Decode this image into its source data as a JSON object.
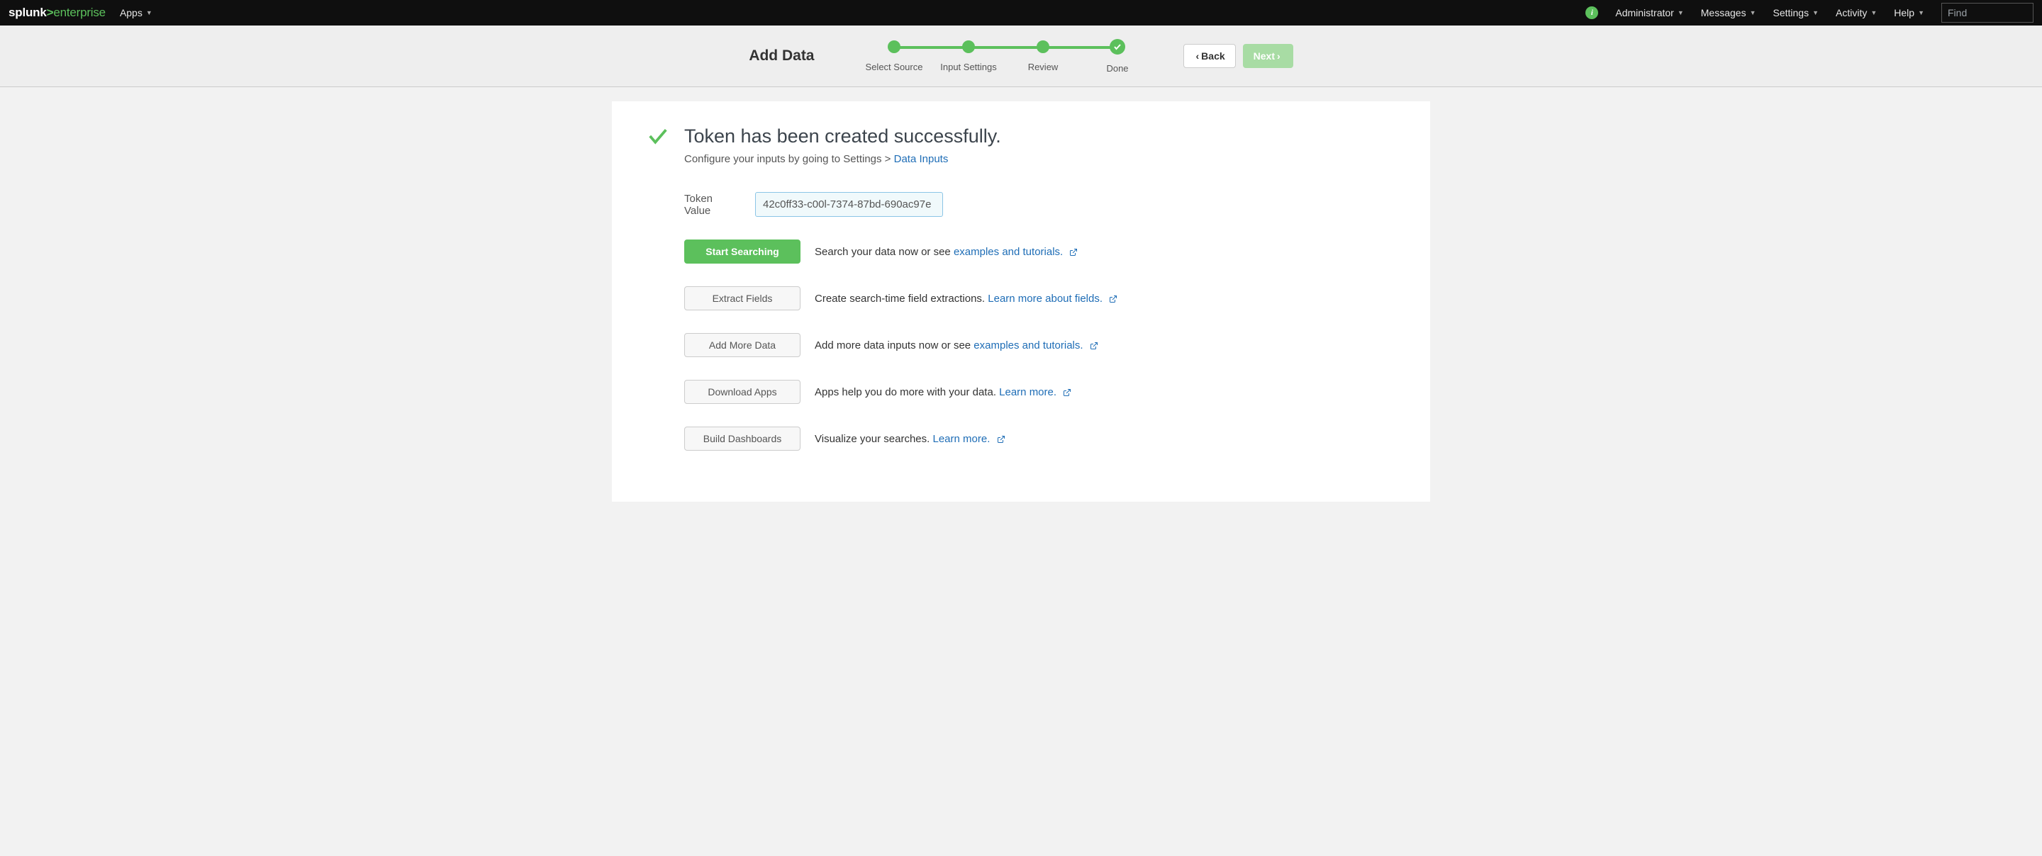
{
  "nav": {
    "brand_splunk": "splunk",
    "brand_enterprise": "enterprise",
    "apps": "Apps",
    "administrator": "Administrator",
    "messages": "Messages",
    "settings": "Settings",
    "activity": "Activity",
    "help": "Help",
    "search_placeholder": "Find"
  },
  "header": {
    "title": "Add Data",
    "steps": [
      "Select Source",
      "Input Settings",
      "Review",
      "Done"
    ],
    "back": "Back",
    "next": "Next"
  },
  "main": {
    "title": "Token has been created successfully.",
    "subtitle_pre": "Configure your inputs by going to Settings > ",
    "subtitle_link": "Data Inputs",
    "token_label": "Token Value",
    "token_value": "42c0ff33-c00l-7374-87bd-690ac97e",
    "actions": {
      "start_searching": {
        "label": "Start Searching",
        "desc": "Search your data now or see ",
        "link": "examples and tutorials."
      },
      "extract_fields": {
        "label": "Extract Fields",
        "desc": "Create search-time field extractions. ",
        "link": "Learn more about fields."
      },
      "add_more_data": {
        "label": "Add More Data",
        "desc": "Add more data inputs now or see ",
        "link": "examples and tutorials."
      },
      "download_apps": {
        "label": "Download Apps",
        "desc": "Apps help you do more with your data. ",
        "link": "Learn more."
      },
      "build_dashboards": {
        "label": "Build Dashboards",
        "desc": "Visualize your searches. ",
        "link": "Learn more."
      }
    }
  }
}
